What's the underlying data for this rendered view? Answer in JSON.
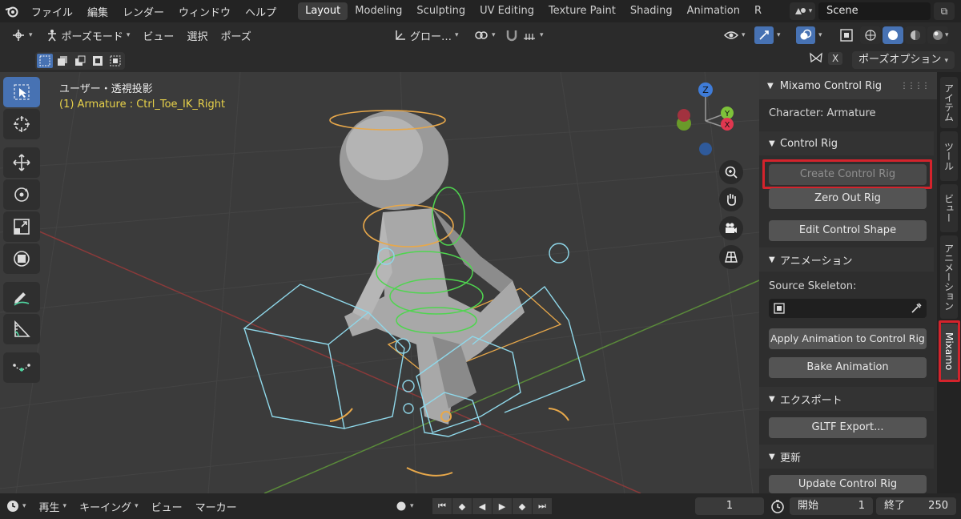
{
  "menu": {
    "items": [
      "ファイル",
      "編集",
      "レンダー",
      "ウィンドウ",
      "ヘルプ"
    ]
  },
  "workspaces": {
    "tabs": [
      "Layout",
      "Modeling",
      "Sculpting",
      "UV Editing",
      "Texture Paint",
      "Shading",
      "Animation",
      "R"
    ],
    "active": "Layout"
  },
  "scene": {
    "label": "Scene"
  },
  "header": {
    "mode": "ポーズモード",
    "menu": [
      "ビュー",
      "選択",
      "ポーズ"
    ],
    "orientation": "グロー…",
    "pose_options": "ポーズオプション",
    "x_label": "X"
  },
  "viewport": {
    "title": "ユーザー・透視投影",
    "subtitle": "(1) Armature : Ctrl_Toe_IK_Right",
    "gizmo": {
      "z": "Z",
      "y": "Y",
      "x": "X"
    }
  },
  "panel": {
    "title": "Mixamo Control Rig",
    "character_label": "Character: Armature",
    "control_rig_section": "Control Rig",
    "create_control_rig": "Create Control Rig",
    "zero_out_rig": "Zero Out Rig",
    "edit_control_shape": "Edit Control Shape",
    "animation_section": "アニメーション",
    "source_skeleton_label": "Source Skeleton:",
    "apply_animation": "Apply Animation to Control Rig",
    "bake_animation": "Bake Animation",
    "export_section": "エクスポート",
    "gltf_export": "GLTF Export...",
    "update_section": "更新",
    "update_control_rig": "Update Control Rig"
  },
  "side_tabs": [
    "アイテム",
    "ツール",
    "ビュー",
    "アニメーション",
    "Mixamo"
  ],
  "timeline": {
    "playback": "再生",
    "keying": "キーイング",
    "view": "ビュー",
    "marker": "マーカー",
    "current_frame": "1",
    "start_label": "開始",
    "start_value": "1",
    "end_label": "終了",
    "end_value": "250"
  },
  "colors": {
    "accent_blue": "#4772b3",
    "highlight_red": "#d4232c",
    "bone_cyan": "#8fd8ea",
    "bone_green": "#4fd54f",
    "bone_orange": "#e8a84a",
    "grid_red": "#8a3a3a",
    "grid_green": "#5a8a3a"
  }
}
